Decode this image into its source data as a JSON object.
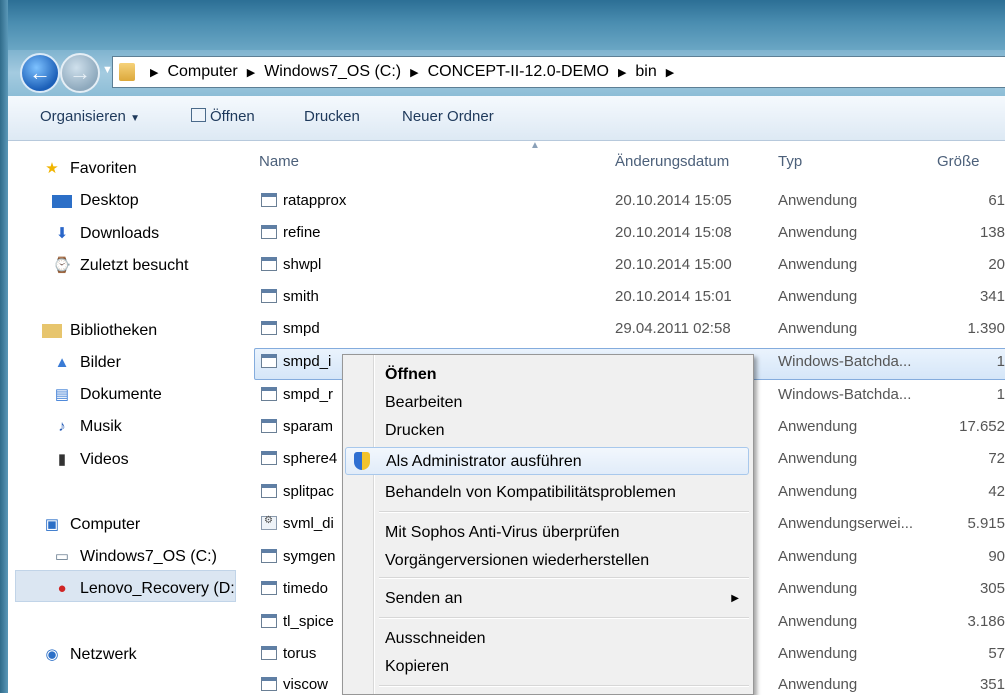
{
  "address": {
    "crumbs": [
      "Computer",
      "Windows7_OS (C:)",
      "CONCEPT-II-12.0-DEMO",
      "bin"
    ]
  },
  "toolbar": {
    "organize": "Organisieren",
    "open": "Öffnen",
    "print": "Drucken",
    "new_folder": "Neuer Ordner"
  },
  "sidebar": {
    "favorites": "Favoriten",
    "desktop": "Desktop",
    "downloads": "Downloads",
    "recent": "Zuletzt besucht",
    "libraries": "Bibliotheken",
    "pictures": "Bilder",
    "documents": "Dokumente",
    "music": "Musik",
    "videos": "Videos",
    "computer": "Computer",
    "drive_c": "Windows7_OS (C:)",
    "drive_d": "Lenovo_Recovery (D:",
    "network": "Netzwerk"
  },
  "columns": {
    "name": "Name",
    "date": "Änderungsdatum",
    "type": "Typ",
    "size": "Größe"
  },
  "files": [
    {
      "name": "ratapprox",
      "date": "20.10.2014 15:05",
      "type": "Anwendung",
      "size": "61"
    },
    {
      "name": "refine",
      "date": "20.10.2014 15:08",
      "type": "Anwendung",
      "size": "138"
    },
    {
      "name": "shwpl",
      "date": "20.10.2014 15:00",
      "type": "Anwendung",
      "size": "20"
    },
    {
      "name": "smith",
      "date": "20.10.2014 15:01",
      "type": "Anwendung",
      "size": "341"
    },
    {
      "name": "smpd",
      "date": "29.04.2011 02:58",
      "type": "Anwendung",
      "size": "1.390"
    },
    {
      "name": "smpd_i",
      "date": "",
      "type": "Windows-Batchda...",
      "size": "1"
    },
    {
      "name": "smpd_r",
      "date": "",
      "type": "Windows-Batchda...",
      "size": "1"
    },
    {
      "name": "sparam",
      "date": "",
      "type": "Anwendung",
      "size": "17.652"
    },
    {
      "name": "sphere4",
      "date": "",
      "type": "Anwendung",
      "size": "72"
    },
    {
      "name": "splitpac",
      "date": "",
      "type": "Anwendung",
      "size": "42"
    },
    {
      "name": "svml_di",
      "date": "",
      "type": "Anwendungserwei...",
      "size": "5.915"
    },
    {
      "name": "symgen",
      "date": "",
      "type": "Anwendung",
      "size": "90"
    },
    {
      "name": "timedo",
      "date": "",
      "type": "Anwendung",
      "size": "305"
    },
    {
      "name": "tl_spice",
      "date": "",
      "type": "Anwendung",
      "size": "3.186"
    },
    {
      "name": "torus",
      "date": "",
      "type": "Anwendung",
      "size": "57"
    },
    {
      "name": "viscow",
      "date": "",
      "type": "Anwendung",
      "size": "351"
    }
  ],
  "context_menu": {
    "open": "Öffnen",
    "edit": "Bearbeiten",
    "print": "Drucken",
    "run_as_admin": "Als Administrator ausführen",
    "compat": "Behandeln von Kompatibilitätsproblemen",
    "sophos": "Mit Sophos Anti-Virus überprüfen",
    "restore": "Vorgängerversionen wiederherstellen",
    "send_to": "Senden an",
    "cut": "Ausschneiden",
    "copy": "Kopieren"
  }
}
